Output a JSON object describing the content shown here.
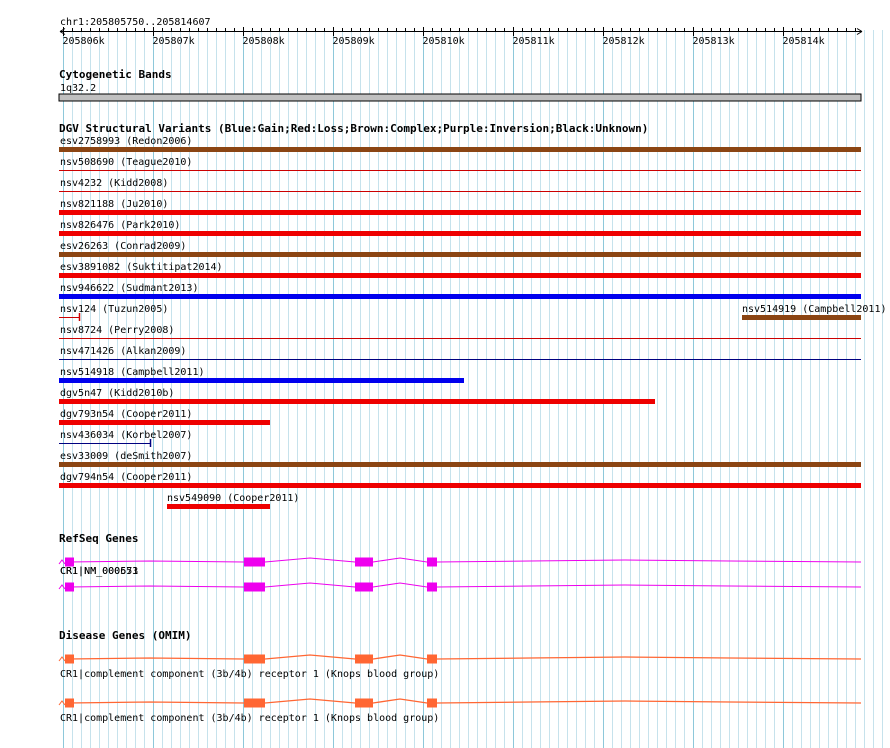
{
  "ruler": {
    "location": "chr1:205805750..205814607",
    "ticks": [
      "205806k",
      "205807k",
      "205808k",
      "205809k",
      "205810k",
      "205811k",
      "205812k",
      "205813k",
      "205814k"
    ]
  },
  "cytoband": {
    "title": "Cytogenetic Bands",
    "band": "1q32.2"
  },
  "dgv": {
    "title": "DGV Structural Variants (Blue:Gain;Red:Loss;Brown:Complex;Purple:Inversion;Black:Unknown)",
    "colors": {
      "gain": "#0000ee",
      "loss": "#ee0000",
      "complex": "#8b4513",
      "thin_red": "#cc0000",
      "thin_blue": "#000080"
    },
    "variants": [
      {
        "label": "esv2758993 (Redon2006)",
        "type": "complex"
      },
      {
        "label": "nsv508690 (Teague2010)",
        "type": "loss_thin"
      },
      {
        "label": "nsv4232 (Kidd2008)",
        "type": "loss_thin"
      },
      {
        "label": "nsv821188 (Ju2010)",
        "type": "loss"
      },
      {
        "label": "nsv826476 (Park2010)",
        "type": "loss"
      },
      {
        "label": "esv26263 (Conrad2009)",
        "type": "complex"
      },
      {
        "label": "esv3891082 (Suktitipat2014)",
        "type": "loss"
      },
      {
        "label": "nsv946622 (Sudmant2013)",
        "type": "gain"
      },
      {
        "label": "nsv124 (Tuzun2005)",
        "type": "loss_small"
      },
      {
        "label": "nsv514919 (Campbell2011)",
        "type": "complex"
      },
      {
        "label": "nsv8724 (Perry2008)",
        "type": "loss_thin"
      },
      {
        "label": "nsv471426 (Alkan2009)",
        "type": "gain_thin"
      },
      {
        "label": "nsv514918 (Campbell2011)",
        "type": "gain"
      },
      {
        "label": "dgv5n47 (Kidd2010b)",
        "type": "loss"
      },
      {
        "label": "dgv793n54 (Cooper2011)",
        "type": "loss"
      },
      {
        "label": "nsv436034 (Korbel2007)",
        "type": "gain_small"
      },
      {
        "label": "esv33009 (deSmith2007)",
        "type": "complex"
      },
      {
        "label": "dgv794n54 (Cooper2011)",
        "type": "loss"
      },
      {
        "label": "nsv549090 (Cooper2011)",
        "type": "loss"
      }
    ]
  },
  "refseq": {
    "title": "RefSeq Genes",
    "color": "#ee00ee",
    "transcripts": [
      {
        "label": "CR1|NM_000573"
      },
      {
        "label": "CR1|NM_000651"
      }
    ]
  },
  "omim": {
    "title": "Disease Genes (OMIM)",
    "color": "#ff6633",
    "genes": [
      {
        "label": "CR1|complement component (3b/4b) receptor 1 (Knops blood group)"
      },
      {
        "label": "CR1|complement component (3b/4b) receptor 1 (Knops blood group)"
      }
    ]
  }
}
